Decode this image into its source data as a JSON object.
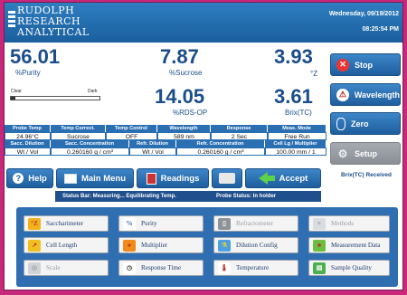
{
  "header": {
    "logo_lines": [
      "RUDOLPH",
      "RESEARCH",
      "ANALYTICAL"
    ],
    "date": "Wednesday, 09/19/2012",
    "time": "08:25:54 PM"
  },
  "readings": {
    "purity": {
      "value": "56.01",
      "unit": "%Purity"
    },
    "sucrose": {
      "value": "7.87",
      "unit": "%Sucrose"
    },
    "z": {
      "value": "3.93",
      "unit": "°Z"
    },
    "rds": {
      "value": "14.05",
      "unit": "%RDS-OP"
    },
    "brix": {
      "value": "3.61",
      "unit": "Brix(TC)"
    }
  },
  "clarity": {
    "clear_label": "Clear",
    "dark_label": "Dark",
    "level": 0.05
  },
  "side_buttons": {
    "stop": "Stop",
    "wavelength": "Wavelength",
    "zero": "Zero",
    "setup": "Setup"
  },
  "info_table": {
    "row1_headers": [
      "Probe Temp",
      "Temp Correct.",
      "Temp Control",
      "Wavelength",
      "Response",
      "Meas. Mode"
    ],
    "row1_values": [
      "24.96°C",
      "Sucrose",
      "OFF",
      "589 nm",
      "2 Sec",
      "Free Run"
    ],
    "row2_headers": [
      "Sacc. Dilution",
      "Sacc. Concentration",
      "Refr. Dilution",
      "Refr. Concentration",
      "Cell Lg / Multiplier"
    ],
    "row2_values": [
      "Wt / Vol",
      "0.260160 g / cm³",
      "Wt / Vol",
      "0.260160 g / cm³",
      "100.00 mm / 1"
    ]
  },
  "actions": {
    "help": "Help",
    "main_menu": "Main Menu",
    "readings": "Readings",
    "accept": "Accept"
  },
  "received": "Brix(TC) Received",
  "status_bar": {
    "left": "Status Bar: Measuring... Equilibrating Temp.",
    "right": "Probe Status: In holder"
  },
  "menu": [
    {
      "label": "Saccharimeter",
      "icon": "saccharimeter-icon",
      "enabled": true
    },
    {
      "label": "Purity",
      "icon": "percent-icon",
      "enabled": true
    },
    {
      "label": "Refractometer",
      "icon": "refractometer-icon",
      "enabled": false
    },
    {
      "label": "Methods",
      "icon": "methods-icon",
      "enabled": false
    },
    {
      "label": "Cell Length",
      "icon": "cell-length-icon",
      "enabled": true
    },
    {
      "label": "Multiplier",
      "icon": "multiplier-icon",
      "enabled": true
    },
    {
      "label": "Dilution Config",
      "icon": "dilution-icon",
      "enabled": true
    },
    {
      "label": "Measurement Data",
      "icon": "measurement-data-icon",
      "enabled": true
    },
    {
      "label": "Scale",
      "icon": "scale-icon",
      "enabled": false
    },
    {
      "label": "Response Time",
      "icon": "clock-icon",
      "enabled": true
    },
    {
      "label": "Temperature",
      "icon": "thermometer-icon",
      "enabled": true
    },
    {
      "label": "Sample Quality",
      "icon": "sample-quality-icon",
      "enabled": true
    }
  ],
  "colors": {
    "brand_blue": "#1a5f9e",
    "frame_magenta": "#c8287c",
    "reading_text": "#1a4d8a"
  }
}
